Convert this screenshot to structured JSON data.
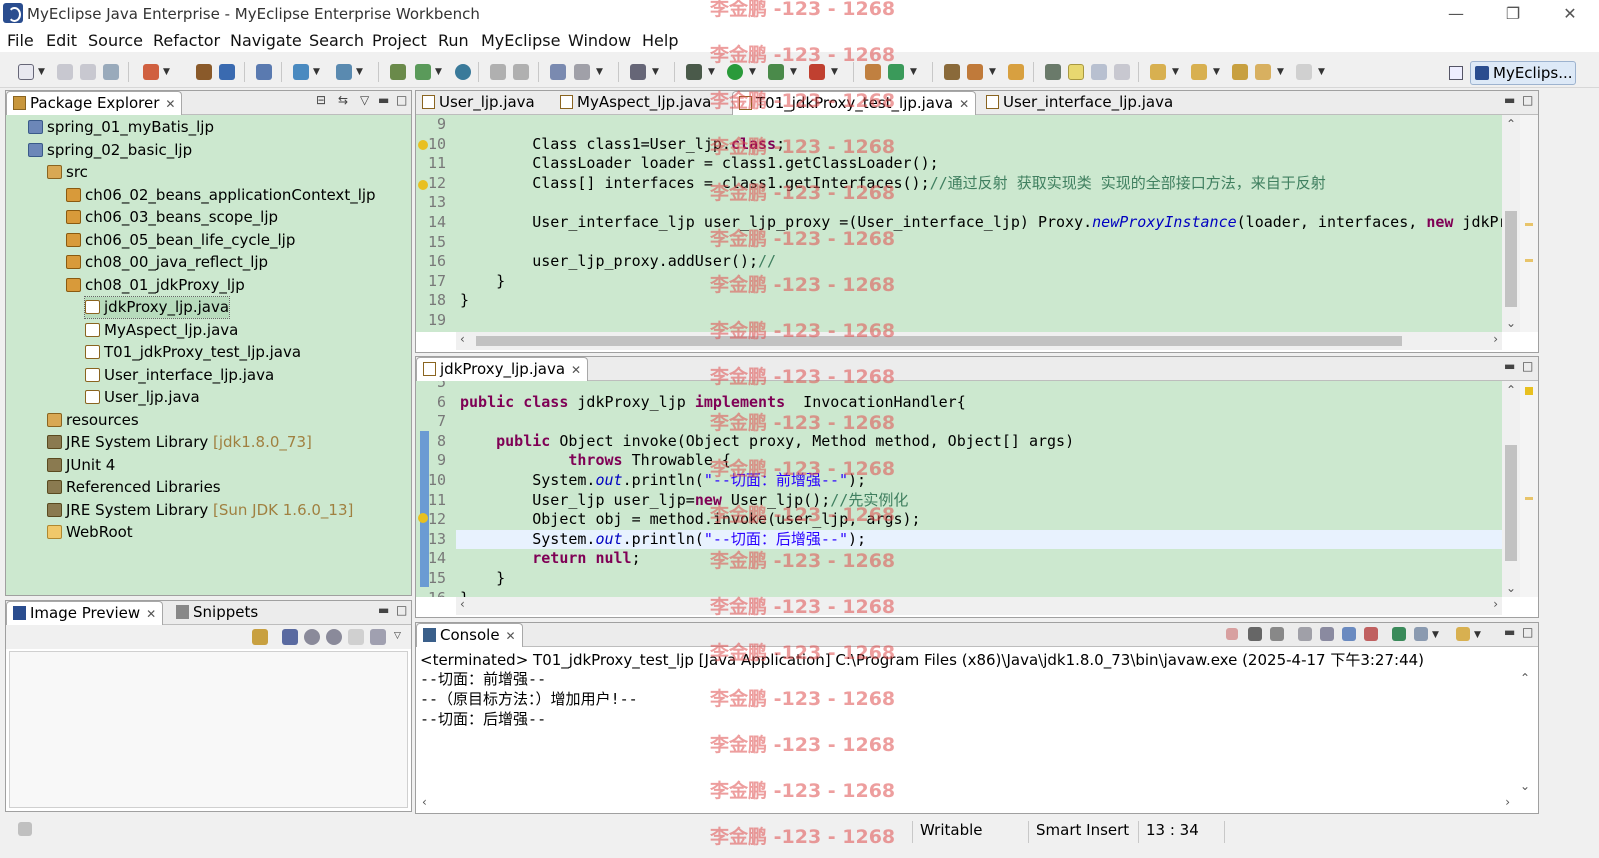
{
  "window": {
    "title": "MyEclipse Java Enterprise - MyEclipse Enterprise Workbench",
    "minimize": "—",
    "restore": "❐",
    "close": "✕"
  },
  "menu": [
    "File",
    "Edit",
    "Source",
    "Refactor",
    "Navigate",
    "Search",
    "Project",
    "Run",
    "MyEclipse",
    "Window",
    "Help"
  ],
  "perspective": {
    "label": "MyEclips..."
  },
  "package_explorer": {
    "tab": "Package Explorer",
    "tree": [
      {
        "label": "spring_01_myBatis_ljp",
        "deco": "",
        "icon": "proj",
        "indent": 0
      },
      {
        "label": "spring_02_basic_ljp",
        "deco": "",
        "icon": "proj",
        "indent": 0
      },
      {
        "label": "src",
        "deco": "",
        "icon": "src",
        "indent": 1
      },
      {
        "label": "ch06_02_beans_applicationContext_ljp",
        "deco": "",
        "icon": "pkg",
        "indent": 2
      },
      {
        "label": "ch06_03_beans_scope_ljp",
        "deco": "",
        "icon": "pkg",
        "indent": 2
      },
      {
        "label": "ch06_05_bean_life_cycle_ljp",
        "deco": "",
        "icon": "pkg",
        "indent": 2
      },
      {
        "label": "ch08_00_java_reflect_ljp",
        "deco": "",
        "icon": "pkg",
        "indent": 2
      },
      {
        "label": "ch08_01_jdkProxy_ljp",
        "deco": "",
        "icon": "pkg",
        "indent": 2
      },
      {
        "label": "jdkProxy_ljp.java",
        "deco": "",
        "icon": "java",
        "indent": 3,
        "selected": true
      },
      {
        "label": "MyAspect_ljp.java",
        "deco": "",
        "icon": "java",
        "indent": 3
      },
      {
        "label": "T01_jdkProxy_test_ljp.java",
        "deco": "",
        "icon": "java",
        "indent": 3
      },
      {
        "label": "User_interface_ljp.java",
        "deco": "",
        "icon": "java",
        "indent": 3
      },
      {
        "label": "User_ljp.java",
        "deco": "",
        "icon": "java",
        "indent": 3
      },
      {
        "label": "resources",
        "deco": "",
        "icon": "src",
        "indent": 1
      },
      {
        "label": "JRE System Library",
        "deco": "[jdk1.8.0_73]",
        "icon": "lib",
        "indent": 1
      },
      {
        "label": "JUnit 4",
        "deco": "",
        "icon": "lib",
        "indent": 1
      },
      {
        "label": "Referenced Libraries",
        "deco": "",
        "icon": "lib",
        "indent": 1
      },
      {
        "label": "JRE System Library",
        "deco": "[Sun JDK 1.6.0_13]",
        "icon": "lib",
        "indent": 1
      },
      {
        "label": "WebRoot",
        "deco": "",
        "icon": "folder",
        "indent": 1
      }
    ]
  },
  "image_preview": {
    "tab": "Image Preview",
    "tab2": "Snippets"
  },
  "top_editor": {
    "tabs": [
      {
        "label": "User_ljp.java",
        "active": false
      },
      {
        "label": "MyAspect_ljp.java",
        "active": false
      },
      {
        "label": "T01_jdkProxy_test_ljp.java",
        "active": true
      },
      {
        "label": "User_interface_ljp.java",
        "active": false
      }
    ],
    "lines": [
      {
        "n": "9",
        "code": []
      },
      {
        "n": "10",
        "code": [
          [
            "",
            "        Class class1=User_ljp."
          ],
          [
            "kw",
            "class"
          ],
          [
            "",
            ";"
          ]
        ]
      },
      {
        "n": "11",
        "code": [
          [
            "",
            "        ClassLoader loader = class1.getClassLoader();"
          ]
        ]
      },
      {
        "n": "12",
        "code": [
          [
            "",
            "        Class[] interfaces = class1.getInterfaces();"
          ],
          [
            "cm",
            "//通过反射 获取实现类 实现的全部接口方法，来自于反射"
          ]
        ]
      },
      {
        "n": "13",
        "code": []
      },
      {
        "n": "14",
        "code": [
          [
            "",
            "        User_interface_ljp user_ljp_proxy =(User_interface_ljp) Proxy."
          ],
          [
            "it",
            "newProxyInstance"
          ],
          [
            "",
            "(loader, interfaces, "
          ],
          [
            "kw",
            "new"
          ],
          [
            "",
            " jdkProxy"
          ]
        ]
      },
      {
        "n": "15",
        "code": []
      },
      {
        "n": "16",
        "code": [
          [
            "",
            "        user_ljp_proxy.addUser();"
          ],
          [
            "cm",
            "//"
          ]
        ]
      },
      {
        "n": "17",
        "code": [
          [
            "",
            "    }"
          ]
        ]
      },
      {
        "n": "18",
        "code": [
          [
            "",
            "}"
          ]
        ]
      },
      {
        "n": "19",
        "code": []
      }
    ]
  },
  "bottom_editor": {
    "tab": "jdkProxy_ljp.java",
    "lines": [
      {
        "n": "5",
        "code": []
      },
      {
        "n": "6",
        "code": [
          [
            "kw",
            "public class"
          ],
          [
            "",
            " jdkProxy_ljp "
          ],
          [
            "kw",
            "implements"
          ],
          [
            "",
            "  InvocationHandler{"
          ]
        ]
      },
      {
        "n": "7",
        "code": []
      },
      {
        "n": "8",
        "code": [
          [
            "",
            "    "
          ],
          [
            "kw",
            "public"
          ],
          [
            "",
            " Object invoke(Object proxy, Method method, Object[] args)"
          ]
        ]
      },
      {
        "n": "9",
        "code": [
          [
            "",
            "            "
          ],
          [
            "kw",
            "throws"
          ],
          [
            "",
            " Throwable {"
          ]
        ]
      },
      {
        "n": "10",
        "code": [
          [
            "",
            "        System."
          ],
          [
            "it",
            "out"
          ],
          [
            "",
            ".println("
          ],
          [
            "str",
            "\"--切面：前增强--\""
          ],
          [
            "",
            ");"
          ]
        ]
      },
      {
        "n": "11",
        "code": [
          [
            "",
            "        User_ljp user_ljp="
          ],
          [
            "kw",
            "new"
          ],
          [
            "",
            " User_ljp();"
          ],
          [
            "cm",
            "//先实例化"
          ]
        ]
      },
      {
        "n": "12",
        "code": [
          [
            "",
            "        Object obj = method.invoke(user_ljp, args);"
          ]
        ]
      },
      {
        "n": "13",
        "code": [
          [
            "",
            "        System."
          ],
          [
            "it",
            "out"
          ],
          [
            "",
            ".println("
          ],
          [
            "str",
            "\"--切面：后增强--\""
          ],
          [
            "",
            ");"
          ]
        ]
      },
      {
        "n": "14",
        "code": [
          [
            "",
            "        "
          ],
          [
            "kw",
            "return null"
          ],
          [
            "",
            ";"
          ]
        ]
      },
      {
        "n": "15",
        "code": [
          [
            "",
            "    }"
          ]
        ]
      },
      {
        "n": "16",
        "code": [
          [
            "",
            "}"
          ]
        ]
      }
    ]
  },
  "console": {
    "tab": "Console",
    "header": "<terminated> T01_jdkProxy_test_ljp [Java Application] C:\\Program Files (x86)\\Java\\jdk1.8.0_73\\bin\\javaw.exe (2025-4-17 下午3:27:44)",
    "lines": [
      "--切面：前增强--",
      "--（原目标方法：）增加用户!--",
      "--切面：后增强--"
    ]
  },
  "status": {
    "writable": "Writable",
    "insert": "Smart Insert",
    "position": "13 : 34"
  },
  "watermark": "李金鹏 -123 - 1268"
}
